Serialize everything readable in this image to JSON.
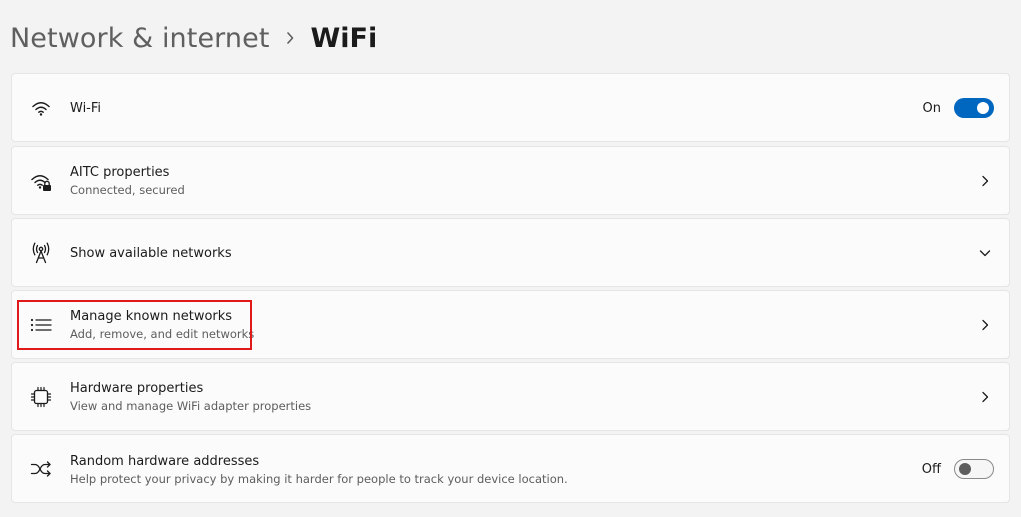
{
  "breadcrumb": {
    "parent": "Network & internet",
    "current": "WiFi"
  },
  "rows": {
    "wifi": {
      "title": "Wi-Fi",
      "icon": "wifi-icon",
      "toggle_label": "On",
      "toggle_state": "on"
    },
    "aitc": {
      "title": "AITC properties",
      "subtitle": "Connected, secured",
      "icon": "wifi-secured-icon"
    },
    "available": {
      "title": "Show available networks",
      "icon": "antenna-icon"
    },
    "known": {
      "title": "Manage known networks",
      "subtitle": "Add, remove, and edit networks",
      "icon": "list-icon"
    },
    "hardware": {
      "title": "Hardware properties",
      "subtitle": "View and manage WiFi adapter properties",
      "icon": "chip-icon"
    },
    "random": {
      "title": "Random hardware addresses",
      "subtitle": "Help protect your privacy by making it harder for people to track your device location.",
      "icon": "shuffle-icon",
      "toggle_label": "Off",
      "toggle_state": "off"
    }
  },
  "colors": {
    "accent": "#0067c0",
    "highlight": "#e01a1a",
    "background": "#f3f3f3",
    "card": "#fbfbfb"
  }
}
